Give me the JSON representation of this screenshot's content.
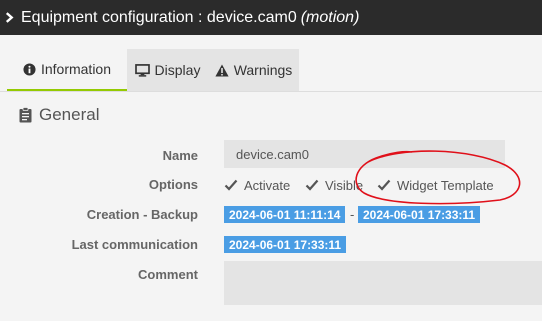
{
  "header": {
    "title": "Equipment configuration : device.cam0",
    "subtitle": "(motion)",
    "icon": "chevron-right-icon"
  },
  "tabs": [
    {
      "label": "Information",
      "icon": "info-circle-icon",
      "active": true
    },
    {
      "label": "Display",
      "icon": "monitor-icon",
      "active": false
    },
    {
      "label": "Warnings",
      "icon": "warning-triangle-icon",
      "active": false
    }
  ],
  "section": {
    "title": "General",
    "icon": "clipboard-icon"
  },
  "form": {
    "name_label": "Name",
    "name_value": "device.cam0",
    "options_label": "Options",
    "options": [
      {
        "label": "Activate",
        "checked": true
      },
      {
        "label": "Visible",
        "checked": true
      },
      {
        "label": "Widget Template",
        "checked": true
      }
    ],
    "creation_label": "Creation - Backup",
    "creation_date": "2024-06-01 11:11:14",
    "backup_separator": "-",
    "backup_date": "2024-06-01 17:33:11",
    "last_comm_label": "Last communication",
    "last_comm_date": "2024-06-01 17:33:11",
    "comment_label": "Comment",
    "comment_value": ""
  },
  "colors": {
    "header_bg": "#2b2b2b",
    "accent_green": "#94ca02",
    "badge_blue": "#4a9de4",
    "annotation_red": "#e0101a"
  }
}
